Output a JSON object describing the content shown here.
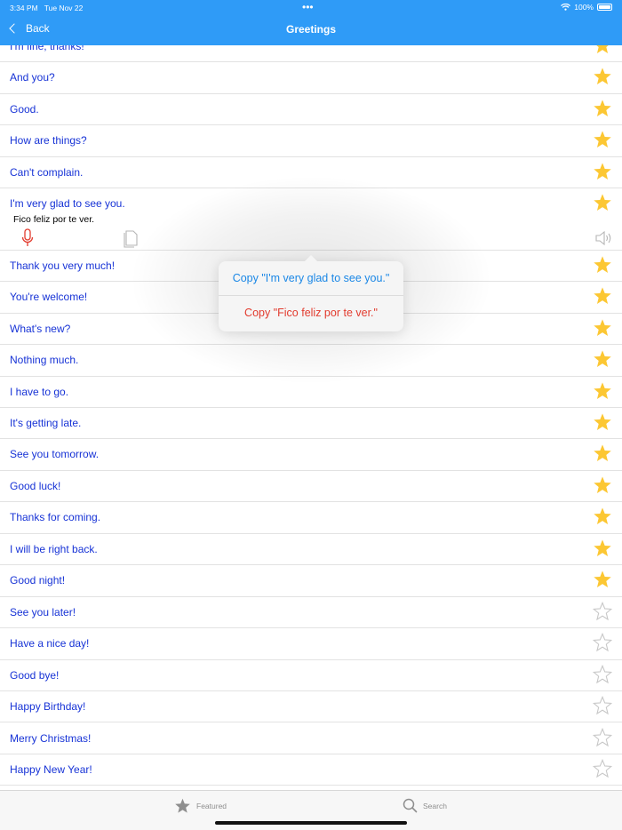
{
  "status_bar": {
    "time": "3:34 PM",
    "date": "Tue Nov 22",
    "battery": "100%",
    "multitask_dots": "•••",
    "icons": [
      "wifi-icon",
      "battery-icon"
    ]
  },
  "nav": {
    "back_label": "Back",
    "title": "Greetings",
    "back_icon": "chevron-left-icon"
  },
  "colors": {
    "header_bg": "#2f9bf7",
    "phrase_text": "#1733d6",
    "star_filled": "#fcc733",
    "star_empty": "#c8c8c8",
    "copy_english": "#1a87e6",
    "copy_translation": "#e23b2e",
    "mic": "#e23b2e"
  },
  "phrases": [
    {
      "text": "I'm fine, thanks!",
      "starred": true
    },
    {
      "text": "And you?",
      "starred": true
    },
    {
      "text": "Good.",
      "starred": true
    },
    {
      "text": "How are things?",
      "starred": true
    },
    {
      "text": "Can't complain.",
      "starred": true
    },
    {
      "text": "I'm very glad to see you.",
      "starred": true,
      "expanded": true,
      "translation": "Fico feliz por te ver."
    },
    {
      "text": "Thank you very much!",
      "starred": true
    },
    {
      "text": "You're welcome!",
      "starred": true
    },
    {
      "text": "What's new?",
      "starred": true
    },
    {
      "text": "Nothing much.",
      "starred": true
    },
    {
      "text": "I have to go.",
      "starred": true
    },
    {
      "text": "It's getting late.",
      "starred": true
    },
    {
      "text": "See you tomorrow.",
      "starred": true
    },
    {
      "text": "Good luck!",
      "starred": true
    },
    {
      "text": "Thanks for coming.",
      "starred": true
    },
    {
      "text": "I will be right back.",
      "starred": true
    },
    {
      "text": "Good night!",
      "starred": true
    },
    {
      "text": "See you later!",
      "starred": false
    },
    {
      "text": "Have a nice day!",
      "starred": false
    },
    {
      "text": "Good bye!",
      "starred": false
    },
    {
      "text": "Happy Birthday!",
      "starred": false
    },
    {
      "text": "Merry Christmas!",
      "starred": false
    },
    {
      "text": "Happy New Year!",
      "starred": false
    }
  ],
  "popup": {
    "copy_english": "Copy \"I'm very glad to see you.\"",
    "copy_translation": "Copy \"Fico feliz por te ver.\""
  },
  "tabs": [
    {
      "label": "Featured",
      "icon": "star-icon"
    },
    {
      "label": "Search",
      "icon": "search-icon"
    }
  ]
}
